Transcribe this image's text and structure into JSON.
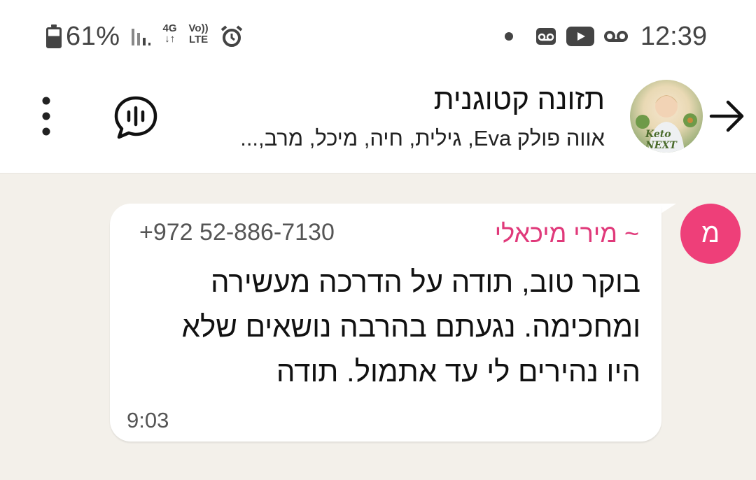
{
  "status_bar": {
    "battery_percent": "61%",
    "network_type": "4G",
    "volte_top": "Vo))",
    "volte_bottom": "LTE",
    "time": "12:39"
  },
  "header": {
    "group_name": "תזונה קטוגנית",
    "members": "אווה פולק Eva, גילית, חיה, מיכל, מרב,...",
    "avatar_text": "Keto NEXT"
  },
  "message": {
    "sender_initial": "מ",
    "sender_name": "~ מירי מיכאלי",
    "sender_phone": "+972 52-886-7130",
    "text": "בוקר טוב, תודה על הדרכה מעשירה ומחכימה. נגעתם בהרבה נושאים שלא היו נהירים לי עד אתמול. תודה",
    "time": "9:03"
  },
  "colors": {
    "accent_pink": "#ee3f79",
    "sender_name": "#e0397a",
    "chat_background": "#f3f0ea"
  }
}
